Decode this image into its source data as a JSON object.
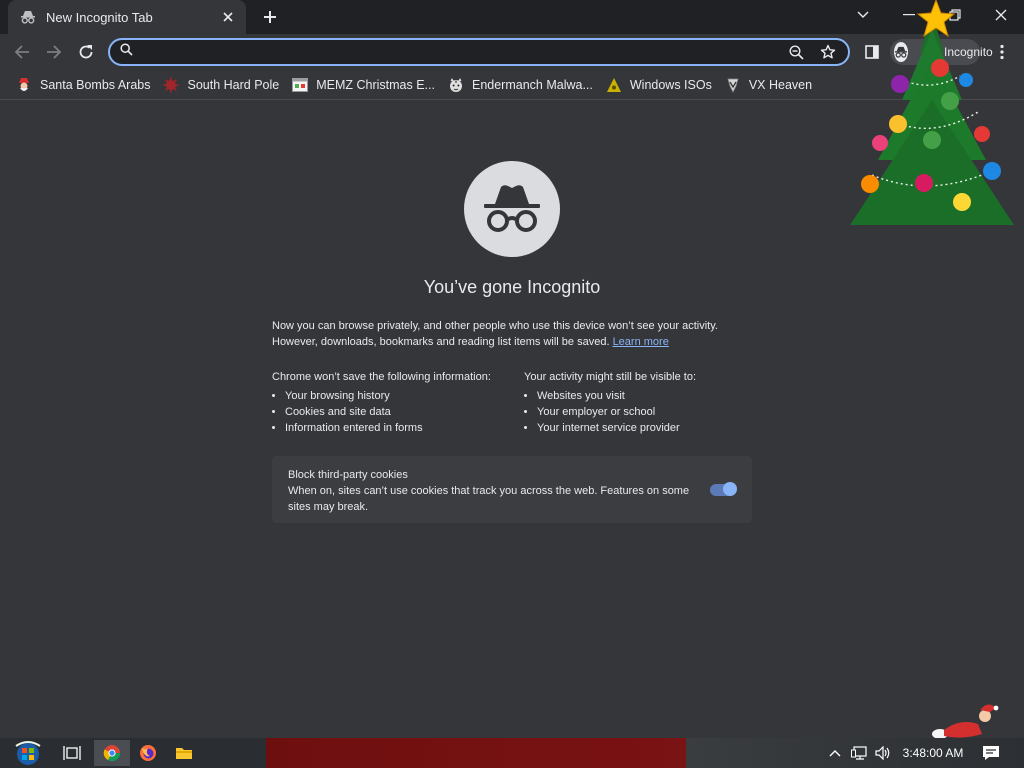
{
  "tab": {
    "title": "New Incognito Tab"
  },
  "omnibox": {
    "value": "",
    "placeholder": ""
  },
  "profile": {
    "label": "Incognito"
  },
  "bookmarks": [
    {
      "label": "Santa Bombs Arabs",
      "icon": "santa-icon"
    },
    {
      "label": "South Hard Pole",
      "icon": "virus-icon"
    },
    {
      "label": "MEMZ Christmas E...",
      "icon": "memz-icon"
    },
    {
      "label": "Endermanch Malwa...",
      "icon": "tiger-icon"
    },
    {
      "label": "Windows ISOs",
      "icon": "iso-icon"
    },
    {
      "label": "VX Heaven",
      "icon": "vx-icon"
    }
  ],
  "main": {
    "headline": "You’ve gone Incognito",
    "intro_text": "Now you can browse privately, and other people who use this device won’t see your activity. However, downloads, bookmarks and reading list items will be saved.",
    "learn_more": "Learn more",
    "left_title": "Chrome won’t save the following information:",
    "left_items": [
      "Your browsing history",
      "Cookies and site data",
      "Information entered in forms"
    ],
    "right_title": "Your activity might still be visible to:",
    "right_items": [
      "Websites you visit",
      "Your employer or school",
      "Your internet service provider"
    ],
    "cookies_title": "Block third-party cookies",
    "cookies_desc": "When on, sites can’t use cookies that track you across the web. Features on some sites may break.",
    "cookies_enabled": true
  },
  "taskbar": {
    "clock": "3:48:00 AM"
  },
  "colors": {
    "accent": "#8ab4f8",
    "background": "#35363a",
    "frame": "#202124"
  }
}
